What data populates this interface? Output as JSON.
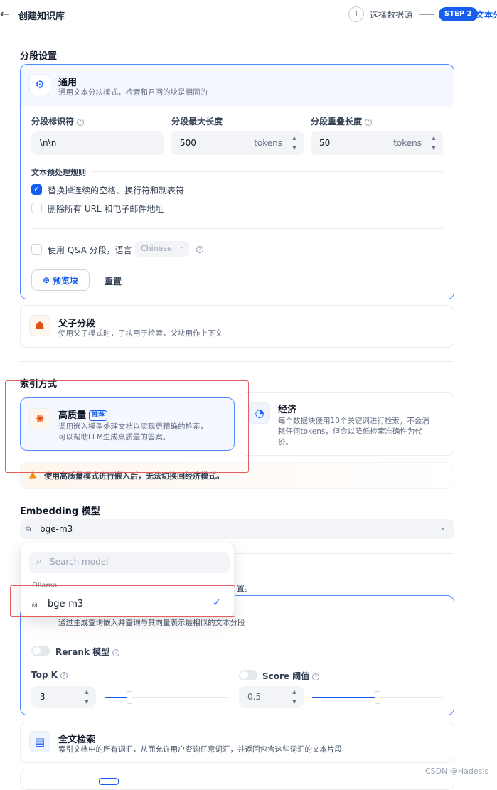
{
  "header": {
    "back": "←",
    "title": "创建知识库",
    "step1_num": "1",
    "step1_label": "选择数据源",
    "step2_badge": "STEP 2",
    "step2_label": "文本分"
  },
  "segment": {
    "section_title": "分段设置",
    "general": {
      "title": "通用",
      "desc": "通用文本分块模式，检索和召回的块是相同的"
    },
    "delimiter": {
      "label": "分段标识符",
      "value": "\\n\\n"
    },
    "max_len": {
      "label": "分段最大长度",
      "value": "500",
      "unit": "tokens"
    },
    "overlap": {
      "label": "分段重叠长度",
      "value": "50",
      "unit": "tokens"
    },
    "rules_title": "文本预处理规则",
    "rule1": "替换掉连续的空格、换行符和制表符",
    "rule2": "删除所有 URL 和电子邮件地址",
    "qa_label": "使用 Q&A 分段，语言",
    "qa_lang": "Chinese",
    "preview_btn": "预览块",
    "reset_btn": "重置",
    "parent": {
      "title": "父子分段",
      "desc": "使用父子模式时，子块用于检索，父块用作上下文"
    }
  },
  "index": {
    "section_title": "索引方式",
    "hq": {
      "title": "高质量",
      "tag": "推荐",
      "desc1": "调用嵌入模型处理文档以实现更精确的检索，",
      "desc2": "可以帮助LLM生成高质量的答案。"
    },
    "eco": {
      "title": "经济",
      "desc1": "每个数据块使用10个关键词进行检索，不会消",
      "desc2": "耗任何tokens，但会以降低检索准确性为代",
      "desc3": "价。"
    },
    "warning": "使用高质量模式进行嵌入后，无法切换回经济模式。"
  },
  "embedding": {
    "section_title": "Embedding 模型",
    "selected": "bge-m3",
    "search_placeholder": "Search model",
    "provider": "Ollama",
    "option": "bge-m3",
    "peek_text": "置。"
  },
  "retrieval": {
    "vector_desc": "通过生成查询嵌入并查询与其向量表示最相似的文本分段",
    "rerank_label": "Rerank 模型",
    "topk_label": "Top K",
    "topk_value": "3",
    "topk_level": 0.2,
    "score_label": "Score 阈值",
    "score_value": "0.5",
    "score_level": 0.5,
    "fulltext": {
      "title": "全文检索",
      "desc": "索引文档中的所有词汇，从而允许用户查询任意词汇，并返回包含这些词汇的文本片段"
    }
  },
  "watermark": "CSDN @Hadesls",
  "colors": {
    "accent": "#155eef",
    "highlight": "#e45d5d",
    "warning": "#f79009"
  }
}
